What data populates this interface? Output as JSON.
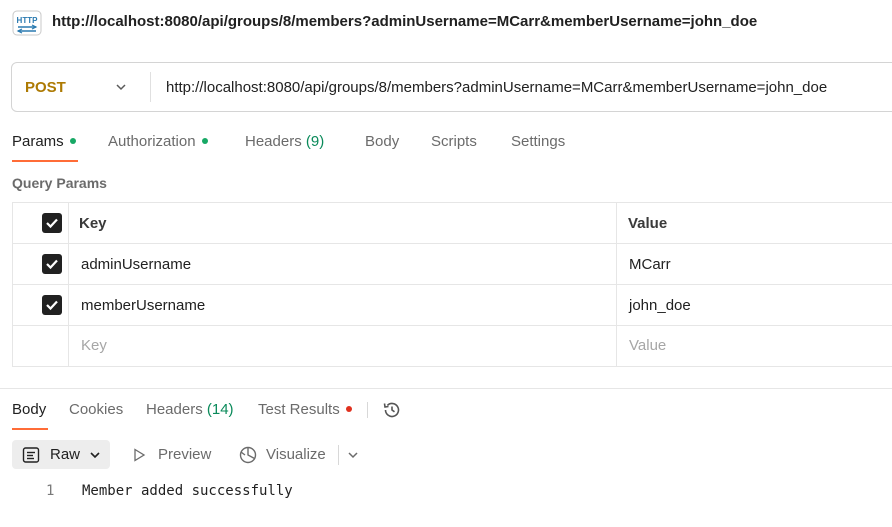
{
  "header": {
    "icon": "http-icon",
    "icon_label": "HTTP",
    "title": "http://localhost:8080/api/groups/8/members?adminUsername=MCarr&memberUsername=john_doe"
  },
  "request": {
    "method": "POST",
    "url": "http://localhost:8080/api/groups/8/members?adminUsername=MCarr&memberUsername=john_doe"
  },
  "request_tabs": [
    {
      "label": "Params",
      "indicator": "green",
      "active": true
    },
    {
      "label": "Authorization",
      "indicator": "green",
      "active": false
    },
    {
      "label": "Headers",
      "count": "(9)",
      "active": false
    },
    {
      "label": "Body",
      "active": false
    },
    {
      "label": "Scripts",
      "active": false
    },
    {
      "label": "Settings",
      "active": false
    }
  ],
  "query_params": {
    "title": "Query Params",
    "columns": {
      "key": "Key",
      "value": "Value"
    },
    "rows": [
      {
        "checked": true,
        "key": "adminUsername",
        "value": "MCarr"
      },
      {
        "checked": true,
        "key": "memberUsername",
        "value": "john_doe"
      }
    ],
    "placeholder": {
      "key": "Key",
      "value": "Value"
    }
  },
  "response_tabs": [
    {
      "label": "Body",
      "active": true
    },
    {
      "label": "Cookies",
      "active": false
    },
    {
      "label": "Headers",
      "count": "(14)",
      "active": false
    },
    {
      "label": "Test Results",
      "indicator": "red",
      "active": false
    }
  ],
  "response_toolbar": {
    "format": "Raw",
    "preview": "Preview",
    "visualize": "Visualize"
  },
  "response_body": {
    "lines": [
      {
        "number": "1",
        "text": "Member added successfully"
      }
    ]
  },
  "colors": {
    "accent": "#ff6c37",
    "method": "#ad7a03",
    "indicator_green": "#17a865",
    "indicator_red": "#e0301e",
    "count": "#0a8a5a"
  }
}
